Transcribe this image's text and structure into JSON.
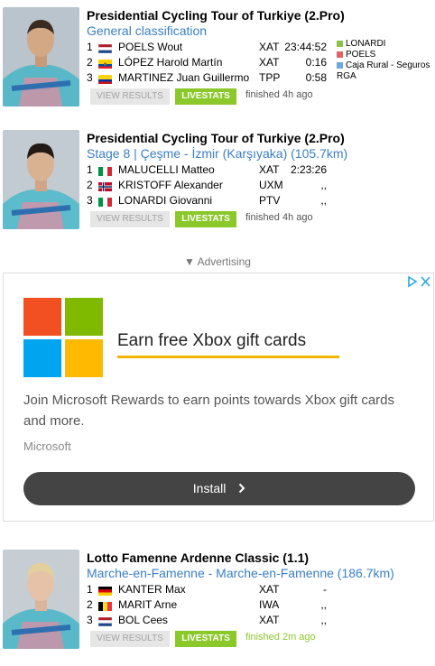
{
  "ad": {
    "label": "▼ Advertising",
    "headline": "Earn free Xbox gift cards",
    "body": "Join Microsoft Rewards to earn points towards Xbox gift cards and more.",
    "brand": "Microsoft",
    "install_label": "Install",
    "colors": {
      "red": "#f25022",
      "green": "#7fba00",
      "blue": "#00a4ef",
      "yellow": "#ffb900",
      "underline": "#f4b400"
    }
  },
  "cards": [
    {
      "title": "Presidential Cycling Tour of Turkiye (2.Pro)",
      "subtitle": "General classification",
      "results": [
        {
          "pos": "1",
          "flag": "netherlands",
          "name": "POELS Wout",
          "team": "XAT",
          "time": "23:44:52"
        },
        {
          "pos": "2",
          "flag": "ecuador",
          "name": "LÓPEZ Harold Martín",
          "team": "XAT",
          "time": "0:16"
        },
        {
          "pos": "3",
          "flag": "colombia",
          "name": "MARTINEZ Juan Guillermo",
          "team": "TPP",
          "time": "0:58"
        }
      ],
      "legend": [
        {
          "color": "#8bc34a",
          "text": "LONARDI"
        },
        {
          "color": "#e06666",
          "text": "POELS"
        },
        {
          "color": "#6fa8dc",
          "text": "Caja Rural - Seguros RGA"
        }
      ],
      "results_label": "VIEW RESULTS",
      "livestats_label": "LIVESTATS",
      "finished": "finished 4h ago"
    },
    {
      "title": "Presidential Cycling Tour of Turkiye (2.Pro)",
      "subtitle": "Stage 8 | Çeşme - İzmir (Karşıyaka) (105.7km)",
      "results": [
        {
          "pos": "1",
          "flag": "italy",
          "name": "MALUCELLI Matteo",
          "team": "XAT",
          "time": "2:23:26"
        },
        {
          "pos": "2",
          "flag": "norway",
          "name": "KRISTOFF Alexander",
          "team": "UXM",
          "time": ",,"
        },
        {
          "pos": "3",
          "flag": "italy",
          "name": "LONARDI Giovanni",
          "team": "PTV",
          "time": ",,"
        }
      ],
      "results_label": "VIEW RESULTS",
      "livestats_label": "LIVESTATS",
      "finished": "finished 4h ago"
    },
    {
      "title": "Lotto Famenne Ardenne Classic (1.1)",
      "subtitle": "Marche-en-Famenne - Marche-en-Famenne (186.7km)",
      "results": [
        {
          "pos": "1",
          "flag": "germany",
          "name": "KANTER Max",
          "team": "XAT",
          "time": "-"
        },
        {
          "pos": "2",
          "flag": "belgium",
          "name": "MARIT Arne",
          "team": "IWA",
          "time": ",,"
        },
        {
          "pos": "3",
          "flag": "netherlands",
          "name": "BOL Cees",
          "team": "XAT",
          "time": ",,"
        }
      ],
      "results_label": "VIEW RESULTS",
      "livestats_label": "LIVESTATS",
      "finished": "finished 2m ago",
      "finished_color": "#8bc82a"
    }
  ]
}
